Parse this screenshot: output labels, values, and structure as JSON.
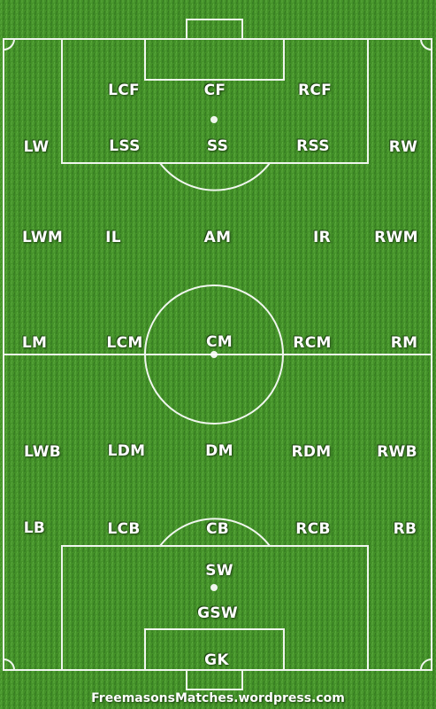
{
  "pitch": {
    "positions": [
      {
        "label": "LCF"
      },
      {
        "label": "CF"
      },
      {
        "label": "RCF"
      },
      {
        "label": "LW"
      },
      {
        "label": "LSS"
      },
      {
        "label": "SS"
      },
      {
        "label": "RSS"
      },
      {
        "label": "RW"
      },
      {
        "label": "LWM"
      },
      {
        "label": "IL"
      },
      {
        "label": "AM"
      },
      {
        "label": "IR"
      },
      {
        "label": "RWM"
      },
      {
        "label": "LM"
      },
      {
        "label": "LCM"
      },
      {
        "label": "CM"
      },
      {
        "label": "RCM"
      },
      {
        "label": "RM"
      },
      {
        "label": "LWB"
      },
      {
        "label": "LDM"
      },
      {
        "label": "DM"
      },
      {
        "label": "RDM"
      },
      {
        "label": "RWB"
      },
      {
        "label": "LB"
      },
      {
        "label": "LCB"
      },
      {
        "label": "CB"
      },
      {
        "label": "RCB"
      },
      {
        "label": "RB"
      },
      {
        "label": "SW"
      },
      {
        "label": "GSW"
      },
      {
        "label": "GK"
      }
    ]
  },
  "footer": {
    "text": "FreemasonsMatches.wordpress.com"
  },
  "colors": {
    "grass_light": "#4f9e33",
    "grass_dark": "#3a8224",
    "lines": "#ffffff"
  }
}
